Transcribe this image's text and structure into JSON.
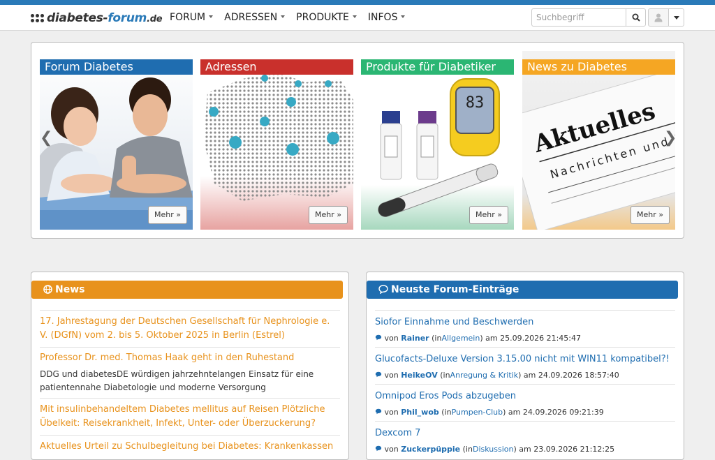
{
  "header": {
    "logo_prefix": "diabetes-",
    "logo_highlight": "forum",
    "logo_tld": ".de",
    "menu": [
      {
        "label": "FORUM"
      },
      {
        "label": "ADRESSEN"
      },
      {
        "label": "PRODUKTE"
      },
      {
        "label": "INFOS"
      }
    ],
    "search_placeholder": "Suchbegriff",
    "accent_color": "#2a7ab8"
  },
  "carousel": {
    "slides": [
      {
        "title": "Forum Diabetes",
        "button": "Mehr »",
        "color": "#1f6db0"
      },
      {
        "title": "Adressen",
        "button": "Mehr »",
        "color": "#c9302c"
      },
      {
        "title": "Produkte für Diabetiker",
        "button": "Mehr »",
        "color": "#2bb673"
      },
      {
        "title": "News zu Diabetes",
        "button": "Mehr »",
        "color": "#f5a623"
      }
    ],
    "meter_reading": "83",
    "newspaper_headline": "Aktuelles",
    "newspaper_subline": "Nachrichten und Even"
  },
  "news": {
    "title": "News",
    "color": "#e8921c",
    "items": [
      {
        "title": "17. Jahrestagung der Deutschen Gesellschaft für Nephrologie e. V. (DGfN) vom 2. bis 5. Oktober 2025 in Berlin (Estrel)",
        "desc": ""
      },
      {
        "title": "Professor Dr. med. Thomas Haak geht in den Ruhestand",
        "desc": "DDG und diabetesDE würdigen jahrzehntelangen Einsatz für eine patientennahe Diabetologie und moderne Versorgung"
      },
      {
        "title": "Mit insulinbehandeltem Diabetes mellitus auf Reisen Plötzliche Übelkeit: Reisekrankheit, Infekt, Unter- oder Überzuckerung?",
        "desc": ""
      },
      {
        "title": "Aktuelles Urteil zu Schulbegleitung bei Diabetes: Krankenkassen",
        "desc": ""
      }
    ]
  },
  "forum": {
    "title": "Neuste Forum-Einträge",
    "color": "#1f6db0",
    "von": "von",
    "in": "(in",
    "am": ") am",
    "items": [
      {
        "title": "Siofor Einnahme und Beschwerden",
        "user": "Rainer",
        "category": "Allgemein",
        "date": "25.09.2026 21:45:47"
      },
      {
        "title": "Glucofacts-Deluxe Version 3.15.00 nicht mit WIN11 kompatibel?!",
        "user": "HeikeOV",
        "category": "Anregung & Kritik",
        "date": "24.09.2026 18:57:40"
      },
      {
        "title": "Omnipod Eros Pods abzugeben",
        "user": "Phil_wob",
        "category": "Pumpen-Club",
        "date": "24.09.2026 09:21:39"
      },
      {
        "title": "Dexcom 7",
        "user": "Zuckerpüppie",
        "category": "Diskussion",
        "date": "23.09.2026 21:12:25"
      }
    ]
  }
}
